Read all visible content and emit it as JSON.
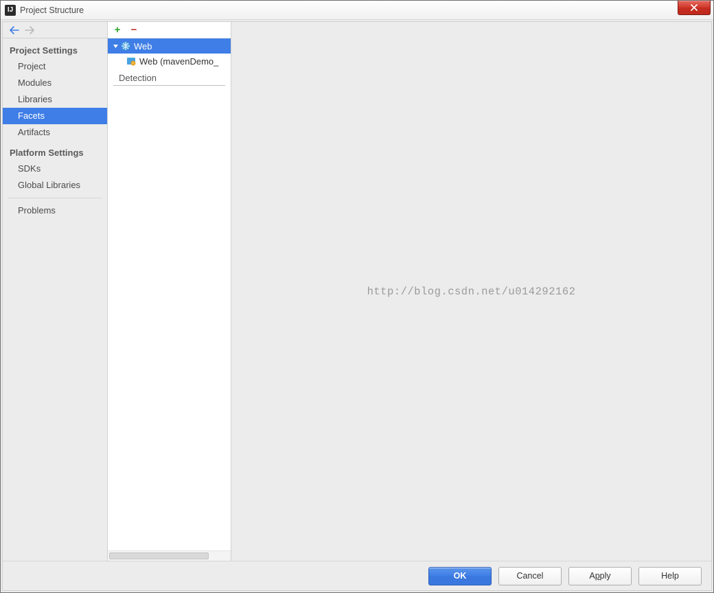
{
  "app_icon_label": "IJ",
  "title": "Project Structure",
  "sidebar": {
    "projectSettings": {
      "heading": "Project Settings",
      "items": [
        "Project",
        "Modules",
        "Libraries",
        "Facets",
        "Artifacts"
      ],
      "selected": "Facets"
    },
    "platformSettings": {
      "heading": "Platform Settings",
      "items": [
        "SDKs",
        "Global Libraries"
      ]
    },
    "problems": "Problems"
  },
  "tree": {
    "root": {
      "label": "Web",
      "expanded": true
    },
    "child": {
      "label": "Web (mavenDemo_"
    },
    "section": "Detection"
  },
  "watermark": "http://blog.csdn.net/u014292162",
  "buttons": {
    "ok": "OK",
    "cancel": "Cancel",
    "apply_pre": "A",
    "apply_ul": "p",
    "apply_post": "ply",
    "help": "Help"
  }
}
